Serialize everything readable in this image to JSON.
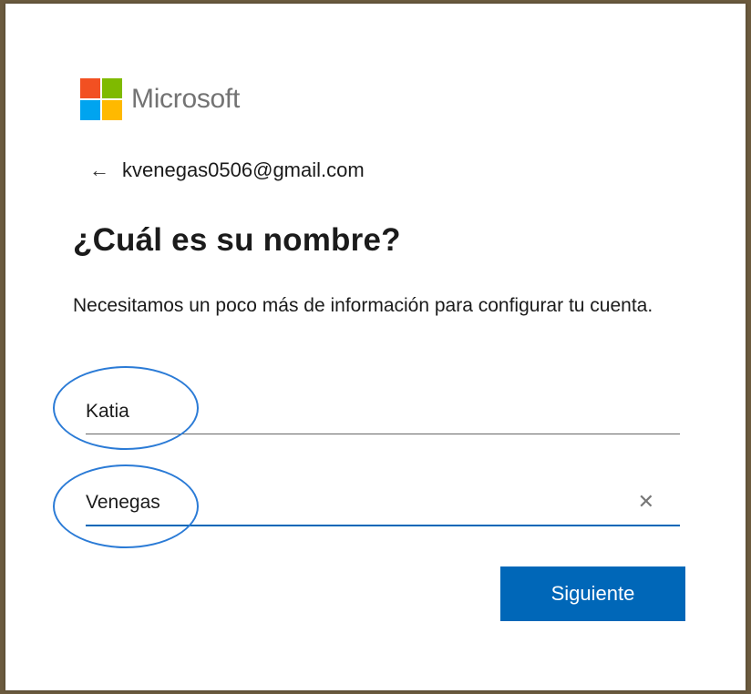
{
  "brand": {
    "name": "Microsoft",
    "logo_colors": [
      "#f25022",
      "#7fba00",
      "#00a4ef",
      "#ffb900"
    ]
  },
  "account": {
    "back_icon": "arrow-left-icon",
    "email": "kvenegas0506@gmail.com"
  },
  "form": {
    "heading": "¿Cuál es su nombre?",
    "description": "Necesitamos un poco más de información para configurar tu cuenta.",
    "first_name": {
      "value": "Katia"
    },
    "last_name": {
      "value": "Venegas",
      "clear_icon": "close-icon"
    },
    "submit_label": "Siguiente"
  },
  "colors": {
    "accent": "#0067b8",
    "annotation": "#2b7bd6"
  }
}
